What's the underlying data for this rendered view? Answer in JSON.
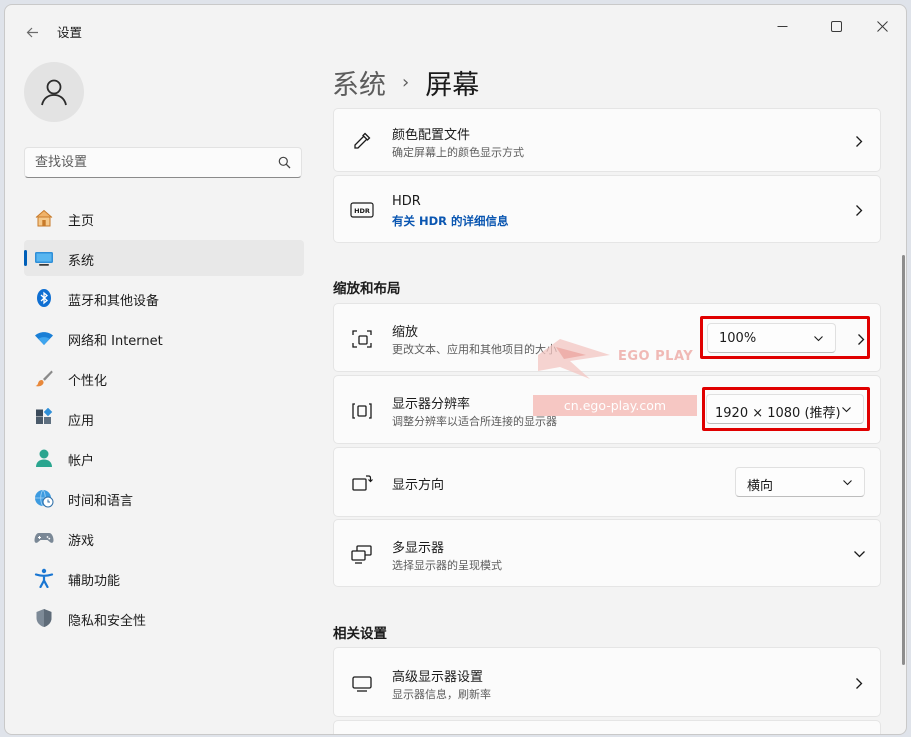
{
  "app": {
    "title": "设置"
  },
  "search": {
    "placeholder": "查找设置"
  },
  "sidebar": {
    "items": [
      {
        "label": "主页",
        "icon": "home-icon"
      },
      {
        "label": "系统",
        "icon": "system-display-icon",
        "selected": true
      },
      {
        "label": "蓝牙和其他设备",
        "icon": "bluetooth-icon"
      },
      {
        "label": "网络和 Internet",
        "icon": "wifi-icon"
      },
      {
        "label": "个性化",
        "icon": "paintbrush-icon"
      },
      {
        "label": "应用",
        "icon": "apps-icon"
      },
      {
        "label": "帐户",
        "icon": "account-icon"
      },
      {
        "label": "时间和语言",
        "icon": "globe-clock-icon"
      },
      {
        "label": "游戏",
        "icon": "gamepad-icon"
      },
      {
        "label": "辅助功能",
        "icon": "accessibility-icon"
      },
      {
        "label": "隐私和安全性",
        "icon": "shield-icon"
      }
    ]
  },
  "breadcrumb": {
    "parent": "系统",
    "separator": "›",
    "current": "屏幕"
  },
  "cards": {
    "color_profile": {
      "title": "颜色配置文件",
      "desc": "确定屏幕上的颜色显示方式"
    },
    "hdr": {
      "title": "HDR",
      "link": "有关 HDR 的详细信息",
      "badge": "HDR"
    }
  },
  "sections": {
    "scale_layout": "缩放和布局",
    "related": "相关设置"
  },
  "scale": {
    "title": "缩放",
    "desc": "更改文本、应用和其他项目的大小",
    "value": "100%"
  },
  "resolution": {
    "title": "显示器分辨率",
    "desc": "调整分辨率以适合所连接的显示器",
    "value": "1920 × 1080 (推荐)"
  },
  "orientation": {
    "title": "显示方向",
    "value": "横向"
  },
  "multi_display": {
    "title": "多显示器",
    "desc": "选择显示器的呈现模式"
  },
  "advanced_display": {
    "title": "高级显示器设置",
    "desc": "显示器信息，刷新率"
  },
  "watermark": {
    "brand": "EGO PLAY",
    "url": "cn.ego-play.com"
  },
  "colors": {
    "accent": "#005fb8",
    "highlight": "#e00000",
    "link": "#0a56b1"
  }
}
